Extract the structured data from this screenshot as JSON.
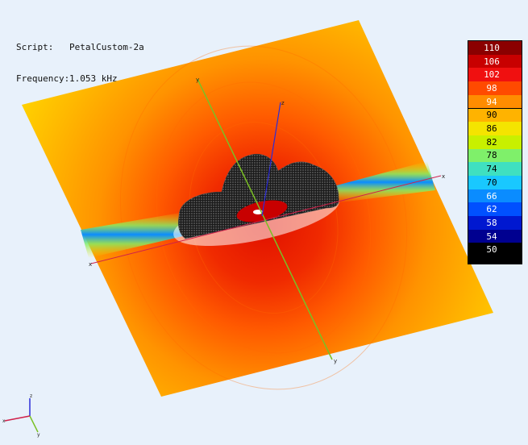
{
  "info": {
    "script_label": "Script:",
    "script_value": "PetalCustom-2a",
    "frequency_label": "Frequency:",
    "frequency_value": "1.053 kHz"
  },
  "legend": {
    "entries": [
      {
        "label": "110",
        "color": "#8b0000"
      },
      {
        "label": "106",
        "color": "#c80000"
      },
      {
        "label": "102",
        "color": "#f01010"
      },
      {
        "label": "98",
        "color": "#ff4a00"
      },
      {
        "label": "94",
        "color": "#ff8c00"
      },
      {
        "label": "90",
        "color": "#ffb300"
      },
      {
        "label": "86",
        "color": "#f4e400"
      },
      {
        "label": "82",
        "color": "#c8f000"
      },
      {
        "label": "78",
        "color": "#7ff06a"
      },
      {
        "label": "74",
        "color": "#3fe0c0"
      },
      {
        "label": "70",
        "color": "#19c8ff"
      },
      {
        "label": "66",
        "color": "#0a8cff"
      },
      {
        "label": "62",
        "color": "#0050ff"
      },
      {
        "label": "58",
        "color": "#0018d0"
      },
      {
        "label": "54",
        "color": "#000090"
      },
      {
        "label": "50",
        "color": "#000000"
      }
    ]
  },
  "axes": {
    "x_label": "x",
    "y_label": "y",
    "z_label": "z"
  },
  "colors": {
    "x_axis": "#d0204a",
    "y_axis": "#7ac024",
    "z_axis": "#2c2cd8"
  }
}
